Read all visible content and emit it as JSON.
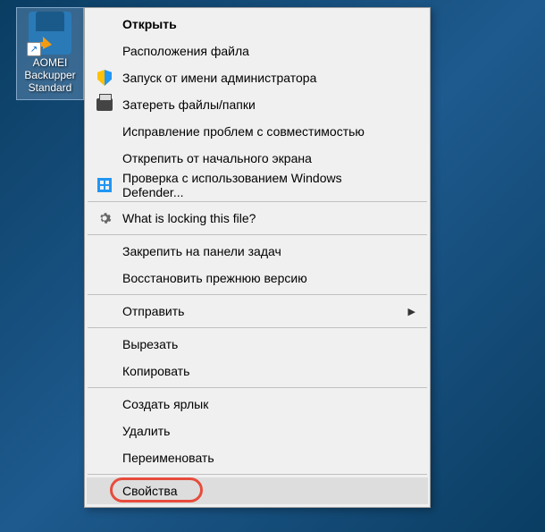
{
  "desktop_icon": {
    "label": "AOMEI Backupper Standard"
  },
  "menu": {
    "open": "Открыть",
    "file_location": "Расположения файла",
    "run_as_admin": "Запуск от имени администратора",
    "erase_files": "Затереть файлы/папки",
    "troubleshoot": "Исправление проблем с совместимостью",
    "unpin_start": "Открепить от начального экрана",
    "defender_check": "Проверка с использованием Windows Defender...",
    "what_locking": "What is locking this file?",
    "pin_taskbar": "Закрепить на панели задач",
    "restore_version": "Восстановить прежнюю версию",
    "send_to": "Отправить",
    "cut": "Вырезать",
    "copy": "Копировать",
    "create_shortcut": "Создать ярлык",
    "delete": "Удалить",
    "rename": "Переименовать",
    "properties": "Свойства"
  }
}
